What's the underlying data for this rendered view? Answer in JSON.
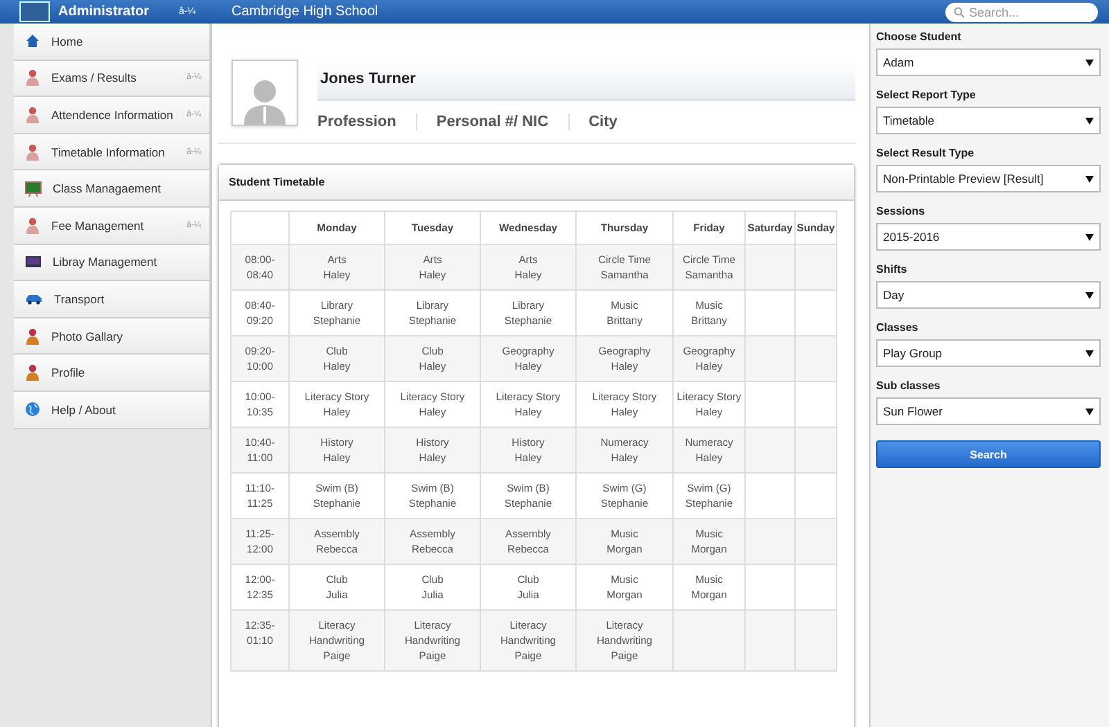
{
  "topbar": {
    "user": "Administrator",
    "user_caret": "â-¼",
    "school": "Cambridge High School",
    "search_placeholder": "Search..."
  },
  "sidebar": {
    "items": [
      {
        "label": "Home"
      },
      {
        "label": "Exams / Results",
        "caret": "â-¼"
      },
      {
        "label": "Attendence Information",
        "caret": "â-¼"
      },
      {
        "label": "Timetable Information",
        "caret": "â-¼"
      },
      {
        "label": "Class Managaement"
      },
      {
        "label": "Fee Management",
        "caret": "â-¼"
      },
      {
        "label": "Libray Management"
      },
      {
        "label": "Transport"
      },
      {
        "label": "Photo Gallary"
      },
      {
        "label": "Profile"
      },
      {
        "label": "Help / About"
      }
    ]
  },
  "profile": {
    "name": "Jones Turner",
    "fields": [
      "Profession",
      "Personal #/ NIC",
      "City"
    ]
  },
  "timetable": {
    "title": "Student Timetable",
    "columns": [
      "Monday",
      "Tuesday",
      "Wednesday",
      "Thursday",
      "Friday",
      "Saturday",
      "Sunday"
    ],
    "rows": [
      {
        "time": "08:00-08:40",
        "cells": [
          {
            "subject": "Arts",
            "teacher": "Haley"
          },
          {
            "subject": "Arts",
            "teacher": "Haley"
          },
          {
            "subject": "Arts",
            "teacher": "Haley"
          },
          {
            "subject": "Circle Time",
            "teacher": "Samantha"
          },
          {
            "subject": "Circle Time",
            "teacher": "Samantha"
          }
        ]
      },
      {
        "time": "08:40-09:20",
        "cells": [
          {
            "subject": "Library",
            "teacher": "Stephanie"
          },
          {
            "subject": "Library",
            "teacher": "Stephanie"
          },
          {
            "subject": "Library",
            "teacher": "Stephanie"
          },
          {
            "subject": "Music",
            "teacher": "Brittany"
          },
          {
            "subject": "Music",
            "teacher": "Brittany"
          }
        ]
      },
      {
        "time": "09:20-10:00",
        "cells": [
          {
            "subject": "Club",
            "teacher": "Haley"
          },
          {
            "subject": "Club",
            "teacher": "Haley"
          },
          {
            "subject": "Geography",
            "teacher": "Haley"
          },
          {
            "subject": "Geography",
            "teacher": "Haley"
          },
          {
            "subject": "Geography",
            "teacher": "Haley"
          }
        ]
      },
      {
        "time": "10:00-10:35",
        "cells": [
          {
            "subject": "Literacy Story",
            "teacher": "Haley"
          },
          {
            "subject": "Literacy Story",
            "teacher": "Haley"
          },
          {
            "subject": "Literacy Story",
            "teacher": "Haley"
          },
          {
            "subject": "Literacy Story",
            "teacher": "Haley"
          },
          {
            "subject": "Literacy Story",
            "teacher": "Haley"
          }
        ]
      },
      {
        "time": "10:40-11:00",
        "cells": [
          {
            "subject": "History",
            "teacher": "Haley"
          },
          {
            "subject": "History",
            "teacher": "Haley"
          },
          {
            "subject": "History",
            "teacher": "Haley"
          },
          {
            "subject": "Numeracy",
            "teacher": "Haley"
          },
          {
            "subject": "Numeracy",
            "teacher": "Haley"
          }
        ]
      },
      {
        "time": "11:10-11:25",
        "cells": [
          {
            "subject": "Swim (B)",
            "teacher": "Stephanie"
          },
          {
            "subject": "Swim (B)",
            "teacher": "Stephanie"
          },
          {
            "subject": "Swim (B)",
            "teacher": "Stephanie"
          },
          {
            "subject": "Swim (G)",
            "teacher": "Stephanie"
          },
          {
            "subject": "Swim (G)",
            "teacher": "Stephanie"
          }
        ]
      },
      {
        "time": "11:25-12:00",
        "cells": [
          {
            "subject": "Assembly",
            "teacher": "Rebecca"
          },
          {
            "subject": "Assembly",
            "teacher": "Rebecca"
          },
          {
            "subject": "Assembly",
            "teacher": "Rebecca"
          },
          {
            "subject": "Music",
            "teacher": "Morgan"
          },
          {
            "subject": "Music",
            "teacher": "Morgan"
          }
        ]
      },
      {
        "time": "12:00-12:35",
        "cells": [
          {
            "subject": "Club",
            "teacher": "Julia"
          },
          {
            "subject": "Club",
            "teacher": "Julia"
          },
          {
            "subject": "Club",
            "teacher": "Julia"
          },
          {
            "subject": "Music",
            "teacher": "Morgan"
          },
          {
            "subject": "Music",
            "teacher": "Morgan"
          }
        ]
      },
      {
        "time": "12:35-01:10",
        "cells": [
          {
            "subject": "Literacy Handwriting",
            "teacher": "Paige"
          },
          {
            "subject": "Literacy Handwriting",
            "teacher": "Paige"
          },
          {
            "subject": "Literacy Handwriting",
            "teacher": "Paige"
          },
          {
            "subject": "Literacy Handwriting",
            "teacher": "Paige"
          }
        ]
      }
    ]
  },
  "filters": [
    {
      "label": "Choose Student",
      "value": "Adam"
    },
    {
      "label": "Select Report Type",
      "value": "Timetable"
    },
    {
      "label": "Select Result Type",
      "value": "Non-Printable Preview [Result]"
    },
    {
      "label": "Sessions",
      "value": "2015-2016"
    },
    {
      "label": "Shifts",
      "value": "Day"
    },
    {
      "label": "Classes",
      "value": "Play Group"
    },
    {
      "label": "Sub classes",
      "value": "Sun Flower"
    }
  ],
  "search_button": "Search"
}
